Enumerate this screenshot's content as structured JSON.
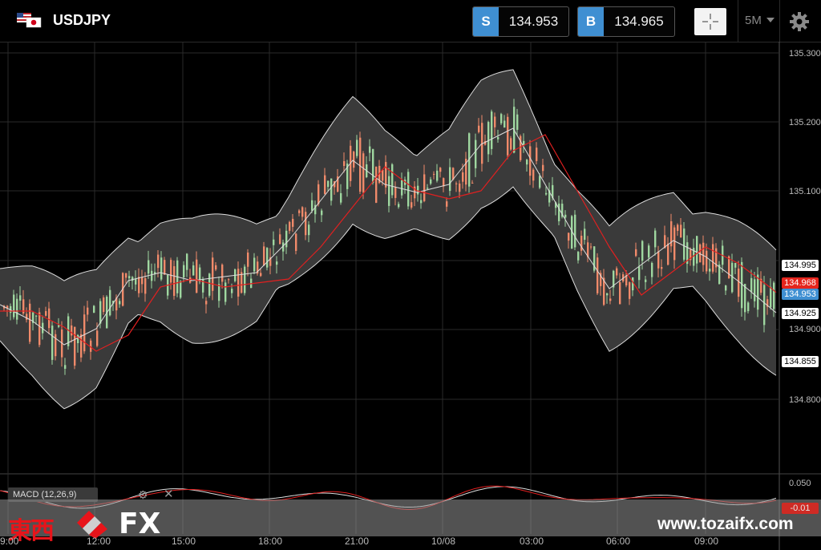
{
  "header": {
    "symbol": "USDJPY",
    "sell_label": "S",
    "sell_price": "134.953",
    "buy_label": "B",
    "buy_price": "134.965",
    "timeframe": "5M"
  },
  "icons": {
    "flags": "us-jp-flag-icon",
    "crosshair": "crosshair-icon",
    "timeframe_caret": "chevron-down-icon",
    "settings": "gear-icon"
  },
  "price_axis": {
    "ticks": [
      "135.300",
      "135.200",
      "135.100",
      "134.900",
      "134.800"
    ],
    "tags": [
      {
        "label": "134.995",
        "bg": "#ffffff",
        "fg": "#000000"
      },
      {
        "label": "134.968",
        "bg": "#e5251d",
        "fg": "#ffffff"
      },
      {
        "label": "134.953",
        "bg": "#3f8fd2",
        "fg": "#ffffff"
      },
      {
        "label": "134.925",
        "bg": "#ffffff",
        "fg": "#000000"
      },
      {
        "label": "134.855",
        "bg": "#ffffff",
        "fg": "#000000"
      }
    ]
  },
  "time_axis": [
    "9:00",
    "12:00",
    "15:00",
    "18:00",
    "21:00",
    "10/08",
    "03:00",
    "06:00",
    "09:00"
  ],
  "macd": {
    "label": "MACD (12,26,9)",
    "ticks": [
      "0.050",
      "-0.01",
      "0.050"
    ]
  },
  "watermark": {
    "kanji": "東西",
    "fx": "FX",
    "url": "www.tozaifx.com"
  },
  "colors": {
    "up_candle": "#9fd7a0",
    "down_candle": "#f08a6a",
    "ma": "#e02020",
    "band": "#ffffff",
    "accent": "#3f8fd2"
  }
}
